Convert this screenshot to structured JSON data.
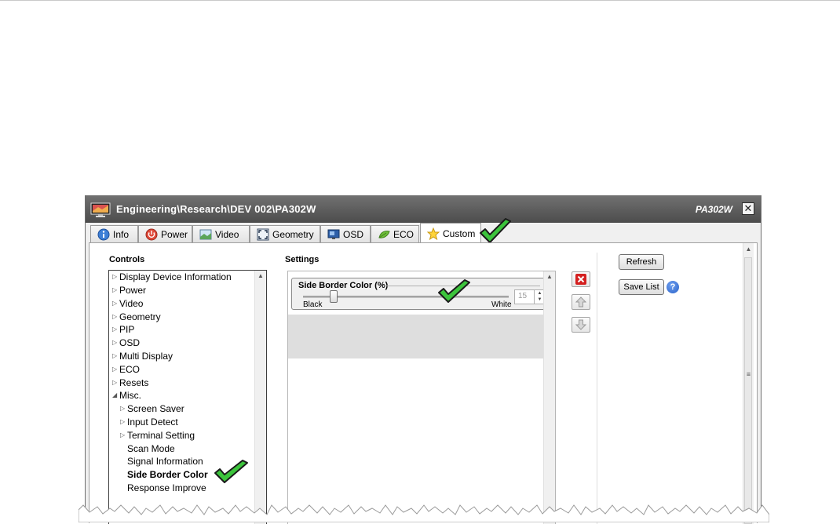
{
  "window": {
    "title": "Engineering\\Research\\DEV 002\\PA302W",
    "model": "PA302W",
    "close_label": "✕"
  },
  "tabs": [
    {
      "label": "Info",
      "icon": "info-icon"
    },
    {
      "label": "Power",
      "icon": "power-icon"
    },
    {
      "label": "Video",
      "icon": "video-icon"
    },
    {
      "label": "Geometry",
      "icon": "geometry-icon"
    },
    {
      "label": "OSD",
      "icon": "osd-icon"
    },
    {
      "label": "ECO",
      "icon": "eco-leaf-icon"
    },
    {
      "label": "Custom",
      "icon": "star-icon",
      "active": true
    }
  ],
  "controls": {
    "heading": "Controls",
    "items": [
      {
        "label": "Display Device Information",
        "arrow": "▷"
      },
      {
        "label": "Power",
        "arrow": "▷"
      },
      {
        "label": "Video",
        "arrow": "▷"
      },
      {
        "label": "Geometry",
        "arrow": "▷"
      },
      {
        "label": "PIP",
        "arrow": "▷"
      },
      {
        "label": "OSD",
        "arrow": "▷"
      },
      {
        "label": "Multi Display",
        "arrow": "▷"
      },
      {
        "label": "ECO",
        "arrow": "▷"
      },
      {
        "label": "Resets",
        "arrow": "▷"
      },
      {
        "label": "Misc.",
        "arrow": "◢"
      },
      {
        "label": "Screen Saver",
        "arrow": "▷"
      },
      {
        "label": "Input Detect",
        "arrow": "▷"
      },
      {
        "label": "Terminal Setting",
        "arrow": "▷"
      },
      {
        "label": "Scan Mode"
      },
      {
        "label": "Signal Information"
      },
      {
        "label": "Side Border Color",
        "selected": true
      },
      {
        "label": "Response Improve"
      }
    ]
  },
  "settings": {
    "heading": "Settings",
    "group_title": "Side Border Color (%)",
    "min_label": "Black",
    "max_label": "White",
    "value": "15",
    "slider_level_percent": 15
  },
  "actions": {
    "refresh_label": "Refresh",
    "save_list_label": "Save List",
    "help_label": "?"
  },
  "colors": {
    "titlebar": "#5c5c5c",
    "checkmark": "#3cc43c",
    "delete_red": "#d42020"
  }
}
